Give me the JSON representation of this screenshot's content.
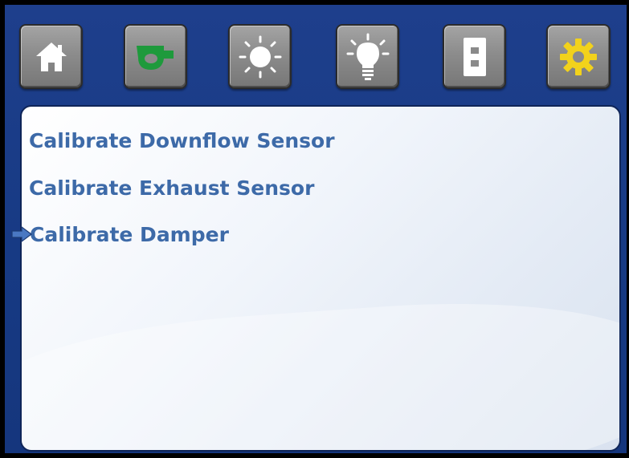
{
  "toolbar": {
    "buttons": [
      {
        "icon": "home-icon",
        "active": false
      },
      {
        "icon": "fan-icon",
        "active": false,
        "icon_color": "#1e9a3c"
      },
      {
        "icon": "sun-icon",
        "active": false
      },
      {
        "icon": "light-bulb-icon",
        "active": false
      },
      {
        "icon": "outlet-icon",
        "active": false
      },
      {
        "icon": "gear-icon",
        "active": true,
        "icon_color": "#f2d21b"
      }
    ]
  },
  "menu": {
    "items": [
      {
        "label": "Calibrate Downflow Sensor"
      },
      {
        "label": "Calibrate Exhaust Sensor"
      },
      {
        "label": "Calibrate Damper"
      }
    ],
    "selected_index": 2
  },
  "colors": {
    "frame_background": "#1e3f8c",
    "menu_text": "#3d6aa8",
    "selection_arrow": "#4a78c2"
  }
}
